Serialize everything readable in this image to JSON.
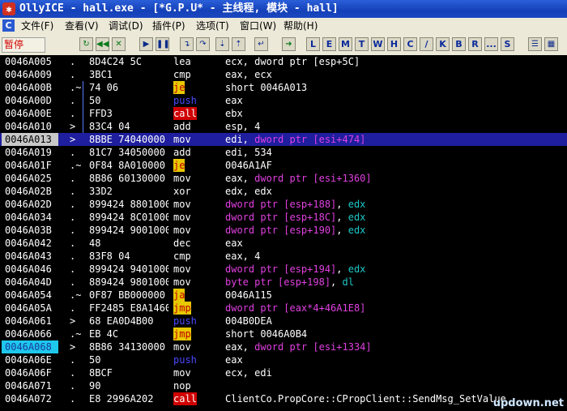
{
  "window": {
    "title": "OllyICE - hall.exe - [*G.P.U* -  主线程, 模块 - hall]",
    "app_icon": "bug-icon"
  },
  "menu": {
    "items": [
      "文件(F)",
      "查看(V)",
      "调试(D)",
      "插件(P)",
      "选项(T)",
      "窗口(W)",
      "帮助(H)"
    ]
  },
  "toolbar": {
    "status": "暂停",
    "letters": [
      "L",
      "E",
      "M",
      "T",
      "W",
      "H",
      "C",
      "/",
      "K",
      "B",
      "R",
      "...",
      "S"
    ]
  },
  "disasm": {
    "rows": [
      {
        "addr": "0046A005",
        "mark": ".",
        "hex": "8D4C24 5C",
        "mnem": "lea",
        "ops": [
          [
            "ecx, ",
            "p"
          ],
          [
            "dword ptr [esp+5C]",
            "p"
          ]
        ]
      },
      {
        "addr": "0046A009",
        "mark": ".",
        "hex": "3BC1",
        "mnem": "cmp",
        "ops": [
          [
            "eax, ecx",
            "p"
          ]
        ]
      },
      {
        "addr": "0046A00B",
        "mark": ".~",
        "hex": "74 06",
        "mnem": "je",
        "ops": [
          [
            "short 0046A013",
            "p"
          ]
        ]
      },
      {
        "addr": "0046A00D",
        "mark": ".",
        "hex": "50",
        "mnem": "push",
        "ops": [
          [
            "eax",
            "p"
          ]
        ]
      },
      {
        "addr": "0046A00E",
        "mark": ".",
        "hex": "FFD3",
        "mnem": "call",
        "ops": [
          [
            "ebx",
            "p"
          ]
        ]
      },
      {
        "addr": "0046A010",
        "mark": ">",
        "hex": "83C4 04",
        "mnem": "add",
        "ops": [
          [
            "esp, 4",
            "p"
          ]
        ]
      },
      {
        "addr": "0046A013",
        "mark": ">",
        "hex": "8BBE 74040000",
        "mnem": "mov",
        "ops": [
          [
            "edi, ",
            "p"
          ],
          [
            "dword ptr [esi+474]",
            "m"
          ]
        ]
      },
      {
        "addr": "0046A019",
        "mark": ".",
        "hex": "81C7 34050000",
        "mnem": "add",
        "ops": [
          [
            "edi, 534",
            "p"
          ]
        ]
      },
      {
        "addr": "0046A01F",
        "mark": ".~",
        "hex": "0F84 8A010000",
        "mnem": "je",
        "ops": [
          [
            "0046A1AF",
            "p"
          ]
        ]
      },
      {
        "addr": "0046A025",
        "mark": ".",
        "hex": "8B86 60130000",
        "mnem": "mov",
        "ops": [
          [
            "eax, ",
            "p"
          ],
          [
            "dword ptr [esi+1360]",
            "m"
          ]
        ]
      },
      {
        "addr": "0046A02B",
        "mark": ".",
        "hex": "33D2",
        "mnem": "xor",
        "ops": [
          [
            "edx, edx",
            "p"
          ]
        ]
      },
      {
        "addr": "0046A02D",
        "mark": ".",
        "hex": "899424 88010000",
        "mnem": "mov",
        "ops": [
          [
            "dword ptr [esp+188]",
            "m"
          ],
          [
            ", ",
            "p"
          ],
          [
            "edx",
            "r"
          ]
        ]
      },
      {
        "addr": "0046A034",
        "mark": ".",
        "hex": "899424 8C010000",
        "mnem": "mov",
        "ops": [
          [
            "dword ptr [esp+18C]",
            "m"
          ],
          [
            ", ",
            "p"
          ],
          [
            "edx",
            "r"
          ]
        ]
      },
      {
        "addr": "0046A03B",
        "mark": ".",
        "hex": "899424 90010000",
        "mnem": "mov",
        "ops": [
          [
            "dword ptr [esp+190]",
            "m"
          ],
          [
            ", ",
            "p"
          ],
          [
            "edx",
            "r"
          ]
        ]
      },
      {
        "addr": "0046A042",
        "mark": ".",
        "hex": "48",
        "mnem": "dec",
        "ops": [
          [
            "eax",
            "p"
          ]
        ]
      },
      {
        "addr": "0046A043",
        "mark": ".",
        "hex": "83F8 04",
        "mnem": "cmp",
        "ops": [
          [
            "eax, 4",
            "p"
          ]
        ]
      },
      {
        "addr": "0046A046",
        "mark": ".",
        "hex": "899424 94010000",
        "mnem": "mov",
        "ops": [
          [
            "dword ptr [esp+194]",
            "m"
          ],
          [
            ", ",
            "p"
          ],
          [
            "edx",
            "r"
          ]
        ]
      },
      {
        "addr": "0046A04D",
        "mark": ".",
        "hex": "889424 98010000",
        "mnem": "mov",
        "ops": [
          [
            "byte ptr [esp+198]",
            "m"
          ],
          [
            ", ",
            "p"
          ],
          [
            "dl",
            "r"
          ]
        ]
      },
      {
        "addr": "0046A054",
        "mark": ".~",
        "hex": "0F87 BB000000",
        "mnem": "ja",
        "ops": [
          [
            "0046A115",
            "p"
          ]
        ]
      },
      {
        "addr": "0046A05A",
        "mark": ".",
        "hex": "FF2485 E8A1460",
        "mnem": "jmp",
        "ops": [
          [
            "dword ptr [eax*4+46A1E8]",
            "m"
          ]
        ]
      },
      {
        "addr": "0046A061",
        "mark": ">",
        "hex": "68 EA0D4B00",
        "mnem": "push",
        "ops": [
          [
            "004B0DEA",
            "p"
          ]
        ]
      },
      {
        "addr": "0046A066",
        "mark": ".~",
        "hex": "EB 4C",
        "mnem": "jmp",
        "ops": [
          [
            "short 0046A0B4",
            "p"
          ]
        ]
      },
      {
        "addr": "0046A068",
        "mark": ">",
        "hex": "8B86 34130000",
        "mnem": "mov",
        "ops": [
          [
            "eax, ",
            "p"
          ],
          [
            "dword ptr [esi+1334]",
            "m"
          ]
        ]
      },
      {
        "addr": "0046A06E",
        "mark": ".",
        "hex": "50",
        "mnem": "push",
        "ops": [
          [
            "eax",
            "p"
          ]
        ]
      },
      {
        "addr": "0046A06F",
        "mark": ".",
        "hex": "8BCF",
        "mnem": "mov",
        "ops": [
          [
            "ecx, edi",
            "p"
          ]
        ]
      },
      {
        "addr": "0046A071",
        "mark": ".",
        "hex": "90",
        "mnem": "nop",
        "ops": [
          [
            "",
            "p"
          ]
        ]
      },
      {
        "addr": "0046A072",
        "mark": ".",
        "hex": "E8 2996A202",
        "mnem": "call",
        "ops": [
          [
            "ClientCo.PropCore::CPropClient::SendMsg_SetValue",
            "p"
          ]
        ]
      }
    ],
    "selected_index": 6,
    "eip_index": 22,
    "highlight_mnem": [
      "je",
      "ja",
      "jmp"
    ],
    "call_mnem": [
      "call"
    ],
    "push_mnem": [
      "push"
    ]
  },
  "watermark": "updown.net"
}
